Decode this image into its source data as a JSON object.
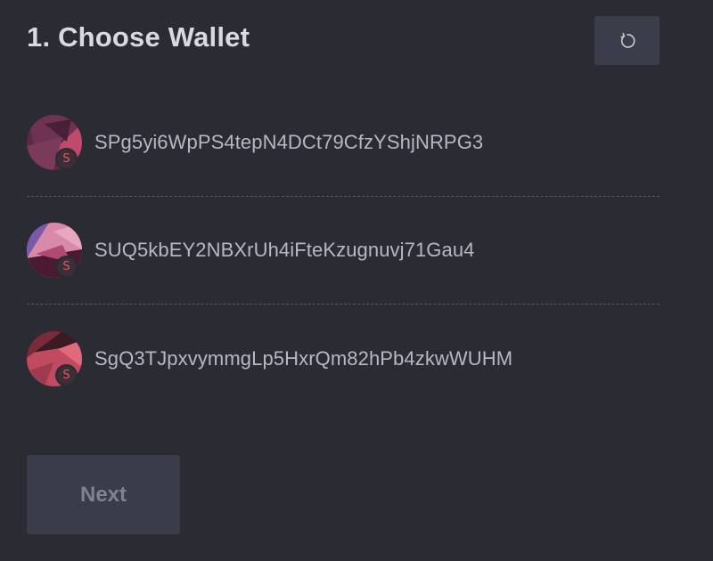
{
  "header": {
    "title": "1. Choose Wallet",
    "refresh_icon": "refresh-icon"
  },
  "wallets": [
    {
      "address": "SPg5yi6WpPS4tepN4DCt79CfzYShjNRPG3",
      "badge": "S",
      "avatar_colors": [
        "#5a2a45",
        "#7a3a5a",
        "#c04a6a",
        "#3a1a30"
      ]
    },
    {
      "address": "SUQ5kbEY2NBXrUh4iFteKzugnuvj71Gau4",
      "badge": "S",
      "avatar_colors": [
        "#d98aa8",
        "#7a5aa8",
        "#4a1a30",
        "#b04a70"
      ]
    },
    {
      "address": "SgQ3TJpxvymmgLp5HxrQm82hPb4zkwWUHM",
      "badge": "S",
      "avatar_colors": [
        "#3a1a25",
        "#c04a60",
        "#7a2a3a",
        "#e06a7a"
      ]
    }
  ],
  "footer": {
    "next_label": "Next"
  },
  "colors": {
    "background": "#2a2b33",
    "button_bg": "#3a3c4a",
    "text_primary": "#d9dae1",
    "text_secondary": "#b6b8c3",
    "badge_accent": "#e05a62"
  }
}
